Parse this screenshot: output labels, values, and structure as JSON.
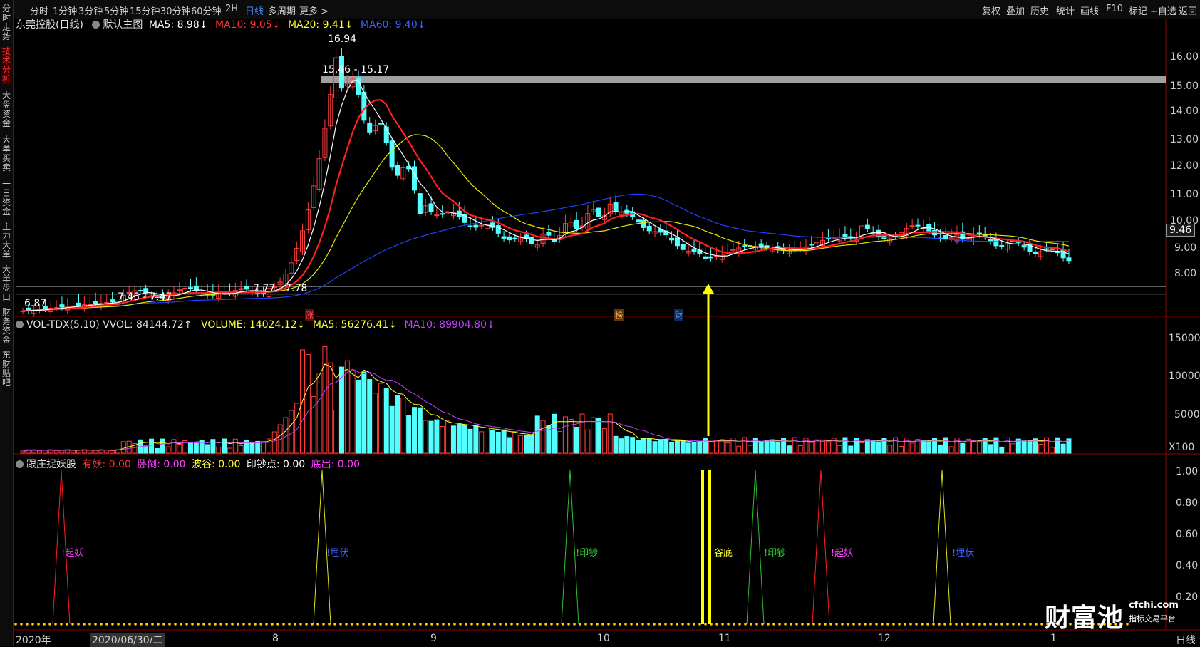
{
  "toolbar": {
    "periods": [
      "分时",
      "1分钟",
      "3分钟",
      "5分钟",
      "15分钟",
      "30分钟",
      "60分钟",
      "2H",
      "日线",
      "多周期",
      "更多 >"
    ],
    "active_period": "日线",
    "right_buttons": [
      "复权",
      "叠加",
      "历史",
      "统计",
      "画线",
      "F10",
      "标记",
      "+自选",
      "返回"
    ]
  },
  "sidebar": [
    "分时走势",
    "技术分析",
    "大盘资金",
    "大单买卖",
    "一日资金",
    "主力大单",
    "大单盘口",
    "财务资金",
    "东财贴吧"
  ],
  "main_chart": {
    "stock": "东莞控股(日线)",
    "template": "默认主图",
    "ma5": "MA5: 8.98↓",
    "ma10": "MA10: 9.05↓",
    "ma20": "MA20: 9.41↓",
    "ma60": "MA60: 9.40↓",
    "high_label": "16.94",
    "zone_label": "15.46 - 15.17",
    "low_zone_label": "7.77 - 7.78",
    "left_label_1": "7.45 - 7.47",
    "left_label_2": "6.87",
    "price_ticks": [
      "16.00",
      "15.00",
      "14.00",
      "13.00",
      "12.00",
      "11.00",
      "10.00",
      "9.00",
      "8.00"
    ],
    "current_price": "9.46",
    "markers": [
      "涨",
      "榜",
      "财"
    ]
  },
  "volume_chart": {
    "title": "VOL-TDX(5,10) VVOL: 84144.72↑",
    "volume": "VOLUME: 14024.12↓",
    "ma5": "MA5: 56276.41↓",
    "ma10": "MA10: 89904.80↓",
    "ticks": [
      "15000",
      "10000",
      "5000",
      "X100"
    ]
  },
  "indicator_chart": {
    "title": "跟庄捉妖股",
    "youyao": "有妖: 0.00",
    "wodao": "卧倒: 0.00",
    "bogu": "波谷: 0.00",
    "yinchao": "印钞点: 0.00",
    "dichu": "底出: 0.00",
    "ticks": [
      "1.00",
      "0.80",
      "0.60",
      "0.40",
      "0.20"
    ],
    "signal_labels": [
      "!起妖",
      "!埋伏",
      "!印钞",
      "谷底",
      "!印钞",
      "!起妖",
      "!埋伏"
    ]
  },
  "date_axis": {
    "labels": [
      "2020年",
      "2020/06/30/二",
      "8",
      "9",
      "10",
      "11",
      "12",
      "1"
    ],
    "period": "日线"
  },
  "colors": {
    "up": "#ff3c3c",
    "down": "#54ffff",
    "ma5": "#ffffff",
    "ma10": "#ff2020",
    "ma20": "#e8e800",
    "ma60": "#2040ff"
  },
  "watermark": {
    "cn": "财富池",
    "en": "cfchi.com",
    "sub": "指标交易平台"
  }
}
